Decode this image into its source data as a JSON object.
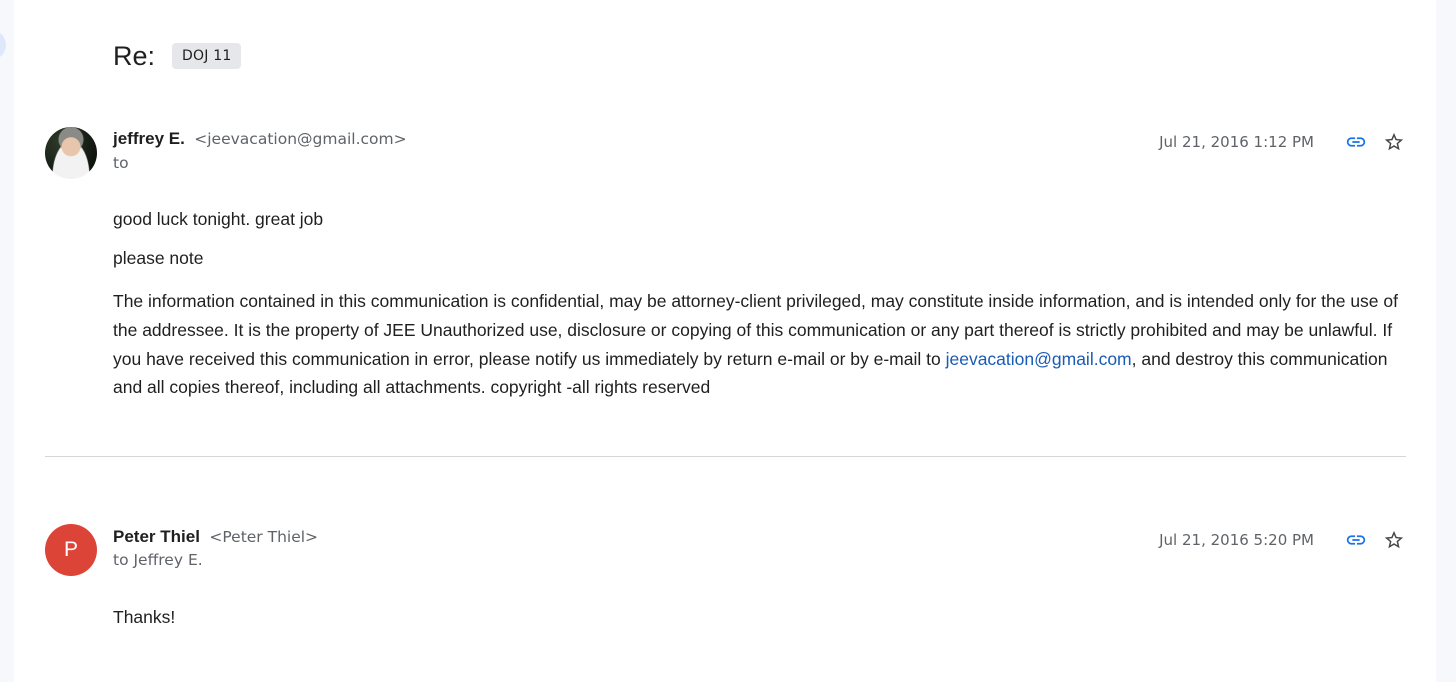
{
  "thread": {
    "subject": "Re:",
    "label": "DOJ 11"
  },
  "messages": [
    {
      "sender_name": "jeffrey E.",
      "sender_email": "<jeevacation@gmail.com>",
      "to_line": "to",
      "timestamp": "Jul 21, 2016 1:12 PM",
      "avatar": "photo",
      "body": {
        "line1": "good luck tonight. great job",
        "line2": "please note",
        "disclaimer_pre": "The information contained in this communication is confidential, may be attorney-client privileged, may constitute inside information, and is intended only for the use of the addressee. It is the property of JEE Unauthorized use, disclosure or copying of this communication or any part thereof is strictly prohibited and may be unlawful. If you have received this communication in error, please notify us immediately by return e-mail or by e-mail to ",
        "disclaimer_link": "jeevacation@gmail.com",
        "disclaimer_post": ", and destroy this communication and all copies thereof, including all attachments. copyright -all rights reserved"
      }
    },
    {
      "sender_name": "Peter Thiel",
      "sender_email": "<Peter Thiel>",
      "to_line": "to Jeffrey E.",
      "timestamp": "Jul 21, 2016 5:20 PM",
      "avatar_letter": "P",
      "body": {
        "line1": "Thanks!"
      }
    }
  ],
  "icons": {
    "link": "link-icon",
    "star": "star-icon"
  },
  "colors": {
    "avatar_p": "#db4437",
    "link": "#1a5bb5",
    "link_icon": "#1a73e8"
  }
}
